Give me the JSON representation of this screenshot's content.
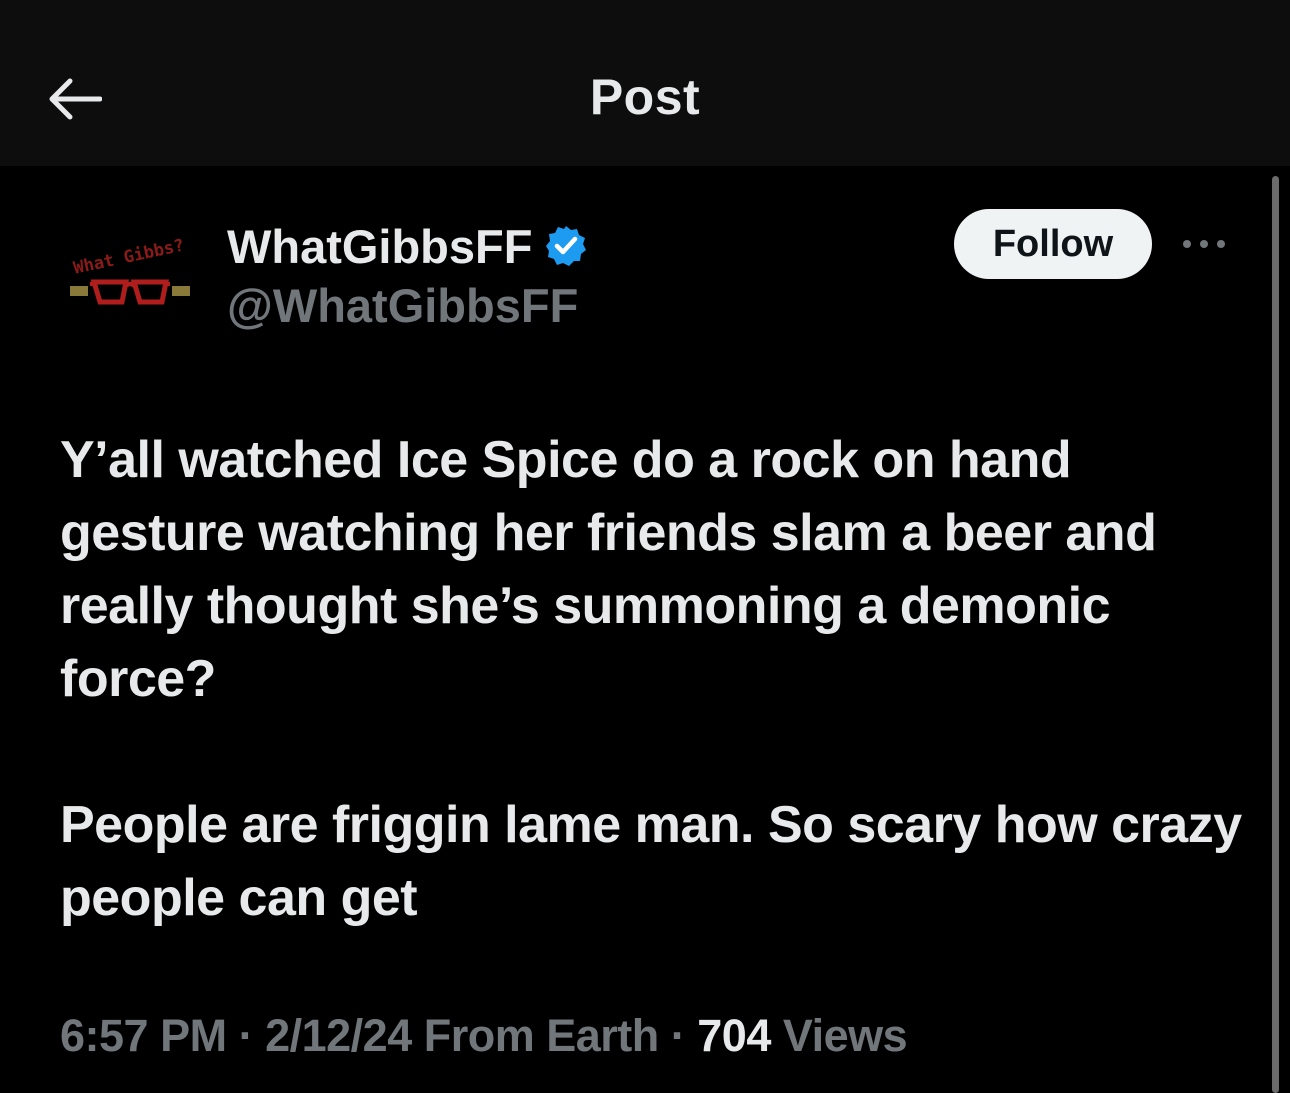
{
  "header": {
    "title": "Post",
    "back_icon": "arrow-left-icon"
  },
  "author": {
    "display_name": "WhatGibbsFF",
    "handle": "@WhatGibbsFF",
    "verified": true,
    "verified_color": "#1d9bf0",
    "avatar_text": "What Gibbs?",
    "avatar_color": "#8b1a1a"
  },
  "actions": {
    "follow_label": "Follow",
    "more_icon": "more-horizontal-icon"
  },
  "post": {
    "paragraphs": [
      "Y’all watched Ice Spice do a rock on hand gesture watching her friends slam a beer and really thought she’s summoning a demonic force?",
      "People are friggin lame man. So scary how crazy people can get"
    ]
  },
  "meta": {
    "time": "6:57 PM",
    "sep1": " · ",
    "date": "2/12/24",
    "source": " From Earth",
    "sep2": " · ",
    "views_count": "704",
    "views_label": " Views"
  }
}
